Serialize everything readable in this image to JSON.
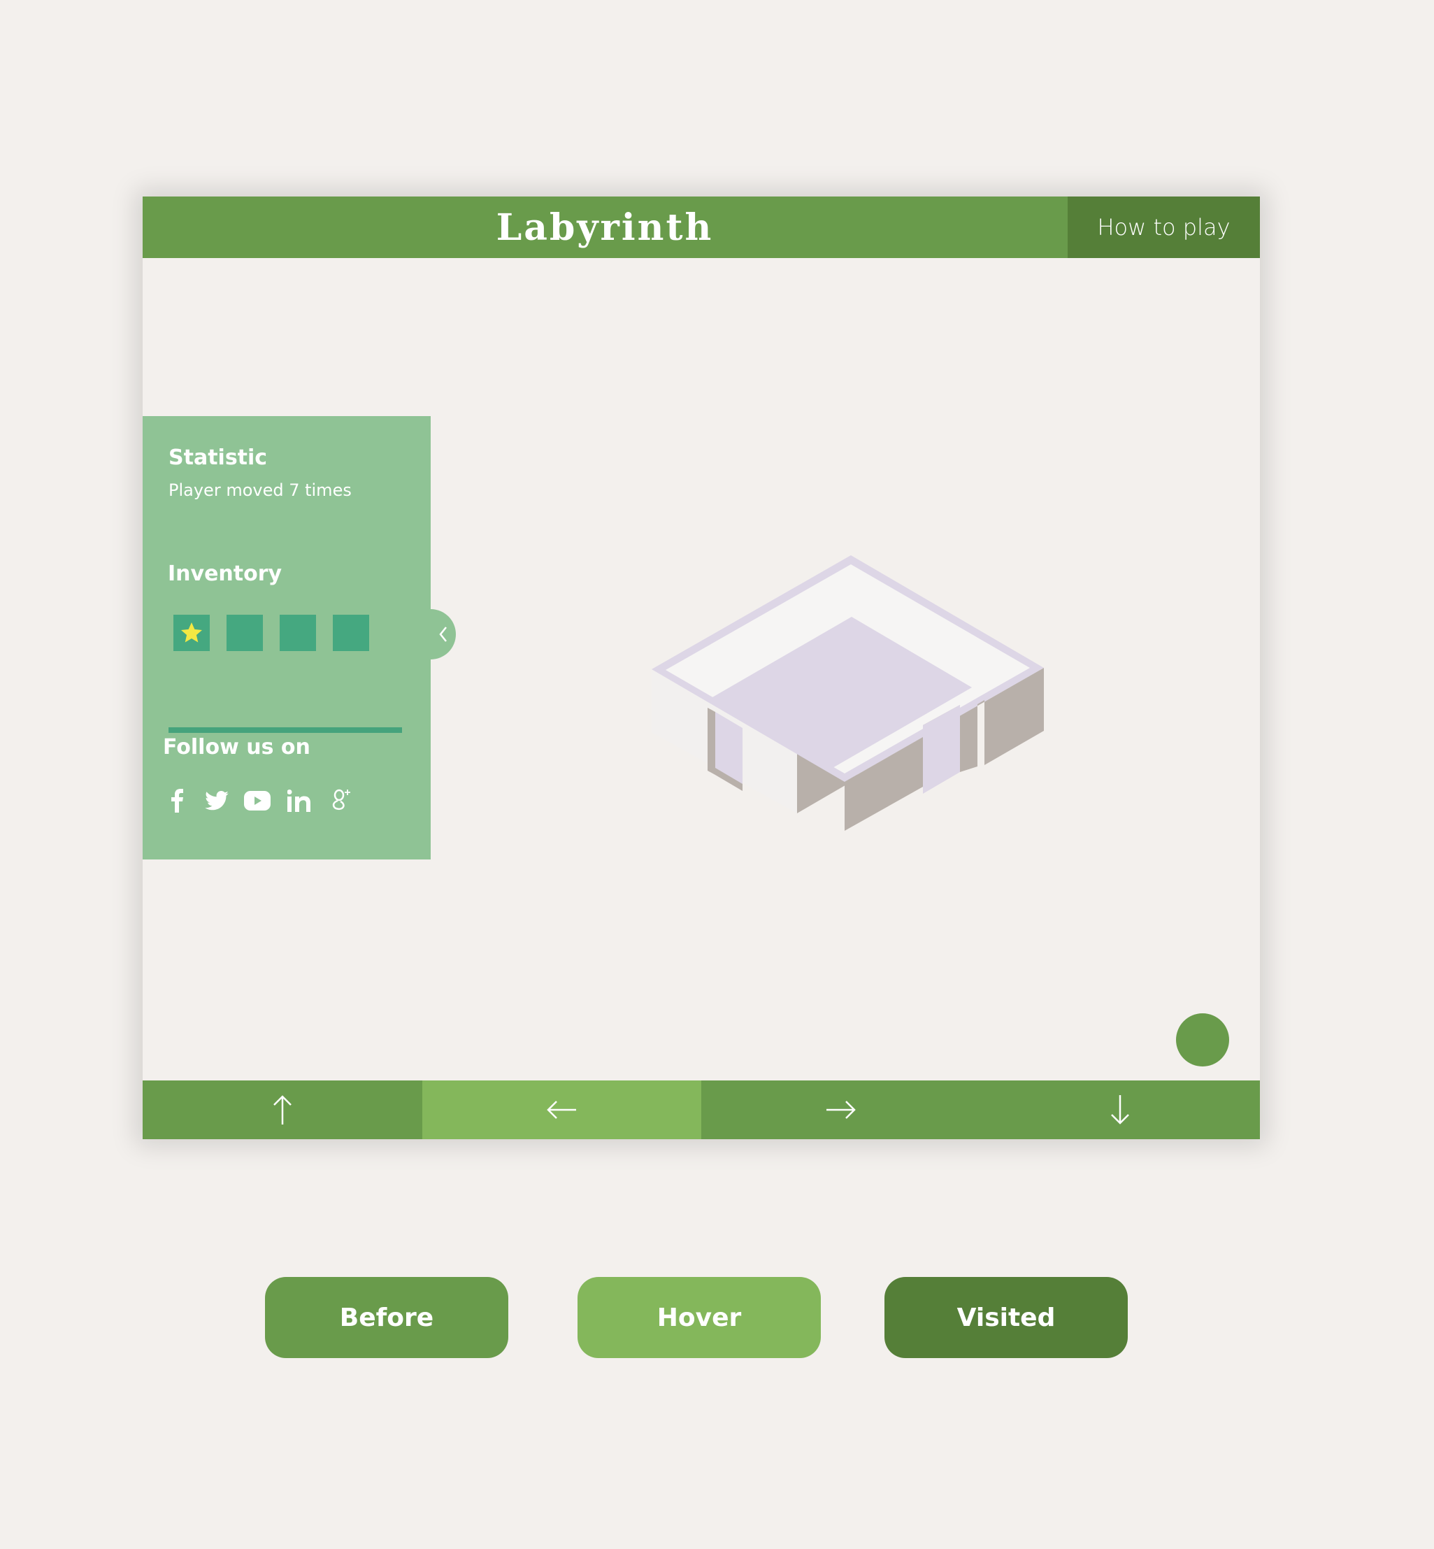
{
  "header": {
    "title": "Labyrinth",
    "how_to_play": "How to play"
  },
  "sidebar": {
    "statistic_title": "Statistic",
    "statistic_text": "Player moved 7 times",
    "inventory_title": "Inventory",
    "inventory_slots": [
      "star",
      "empty",
      "empty",
      "empty"
    ],
    "follow_title": "Follow us on",
    "social_icons": [
      "facebook-icon",
      "twitter-icon",
      "youtube-icon",
      "linkedin-icon",
      "google-plus-icon"
    ]
  },
  "controls": {
    "up": "up-arrow-icon",
    "left": "left-arrow-icon",
    "right": "right-arrow-icon",
    "down": "down-arrow-icon",
    "hovered": "left"
  },
  "button_states": {
    "before": "Before",
    "hover": "Hover",
    "visited": "Visited"
  },
  "colors": {
    "primary": "#699b4b",
    "hover": "#84b75b",
    "visited": "#557f38",
    "sidebar": "#8fc395",
    "accent": "#45a37c",
    "background": "#f3f0ed",
    "star": "#f4e843",
    "room_floor": "#ddd6e6"
  }
}
